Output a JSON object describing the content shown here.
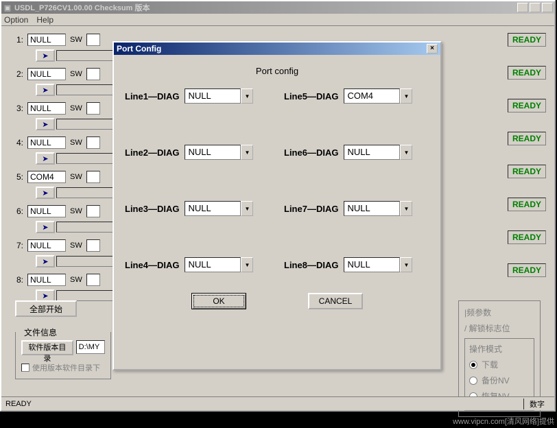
{
  "window": {
    "title": "USDL_P726CV1.00.00 Checksum 版本"
  },
  "menu": {
    "option": "Option",
    "help": "Help"
  },
  "rows": [
    {
      "num": "1:",
      "port": "NULL",
      "sw": "SW",
      "ready": "READY"
    },
    {
      "num": "2:",
      "port": "NULL",
      "sw": "SW",
      "ready": "READY"
    },
    {
      "num": "3:",
      "port": "NULL",
      "sw": "SW",
      "ready": "READY"
    },
    {
      "num": "4:",
      "port": "NULL",
      "sw": "SW",
      "ready": "READY"
    },
    {
      "num": "5:",
      "port": "COM4",
      "sw": "SW",
      "ready": "READY"
    },
    {
      "num": "6:",
      "port": "NULL",
      "sw": "SW",
      "ready": "READY"
    },
    {
      "num": "7:",
      "port": "NULL",
      "sw": "SW",
      "ready": "READY"
    },
    {
      "num": "8:",
      "port": "NULL",
      "sw": "SW",
      "ready": "READY"
    }
  ],
  "startAll": "全部开始",
  "fileInfo": {
    "groupTitle": "文件信息",
    "swVersionDir": "软件版本目录",
    "path": "D:\\MY",
    "useVersionDir": "使用版本软件目录下"
  },
  "rightPanel": {
    "line1": "|频参数",
    "line2": "/ 解锁标志位",
    "opMode": "操作模式",
    "download": "下载",
    "backupNV": "备份NV",
    "restoreNV": "恢复NV"
  },
  "statusbar": {
    "left": "READY",
    "right": "数字"
  },
  "dialog": {
    "title": "Port Config",
    "subtitle": "Port config",
    "lines": [
      {
        "label": "Line1—DIAG",
        "value": "NULL"
      },
      {
        "label": "Line2—DIAG",
        "value": "NULL"
      },
      {
        "label": "Line3—DIAG",
        "value": "NULL"
      },
      {
        "label": "Line4—DIAG",
        "value": "NULL"
      },
      {
        "label": "Line5—DIAG",
        "value": "COM4"
      },
      {
        "label": "Line6—DIAG",
        "value": "NULL"
      },
      {
        "label": "Line7—DIAG",
        "value": "NULL"
      },
      {
        "label": "Line8—DIAG",
        "value": "NULL"
      }
    ],
    "ok": "OK",
    "cancel": "CANCEL"
  },
  "watermark": "www.vipcn.com[清风网络]提供"
}
